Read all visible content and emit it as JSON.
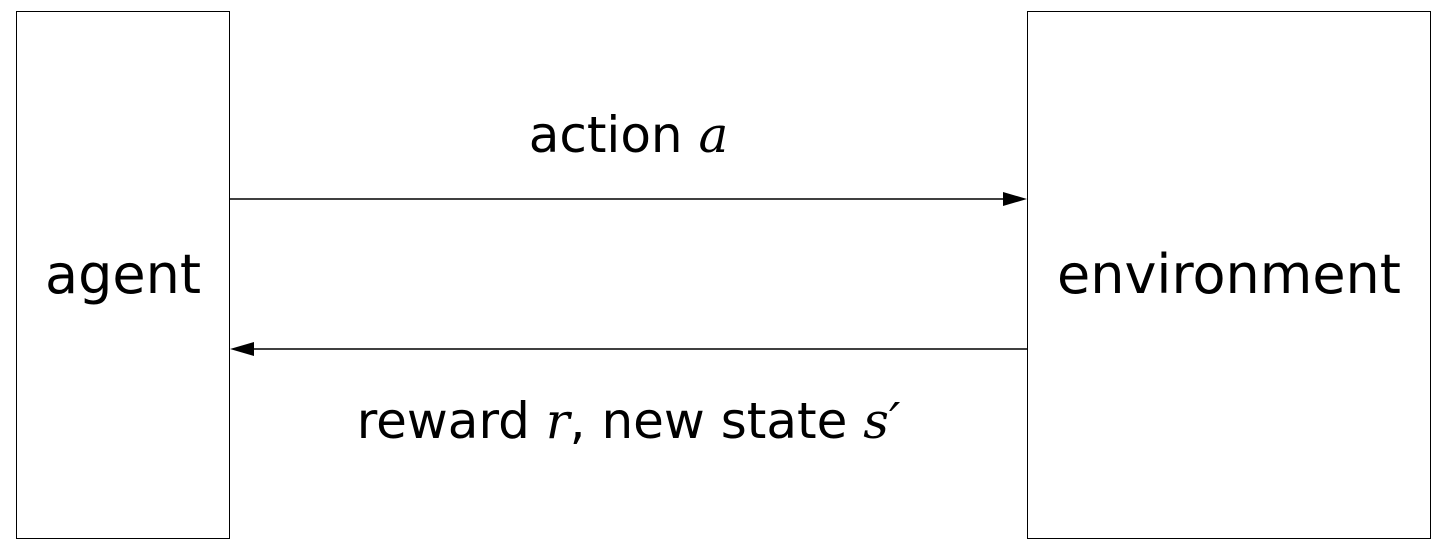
{
  "nodes": {
    "agent": {
      "label": "agent"
    },
    "environment": {
      "label": "environment"
    }
  },
  "edges": {
    "action": {
      "text": "action",
      "symbol": "a"
    },
    "feedback": {
      "text_reward": "reward",
      "symbol_reward": "r",
      "separator": ",",
      "text_state": "new state",
      "symbol_state": "s′"
    }
  },
  "colors": {
    "stroke": "#000000",
    "background": "#ffffff"
  }
}
